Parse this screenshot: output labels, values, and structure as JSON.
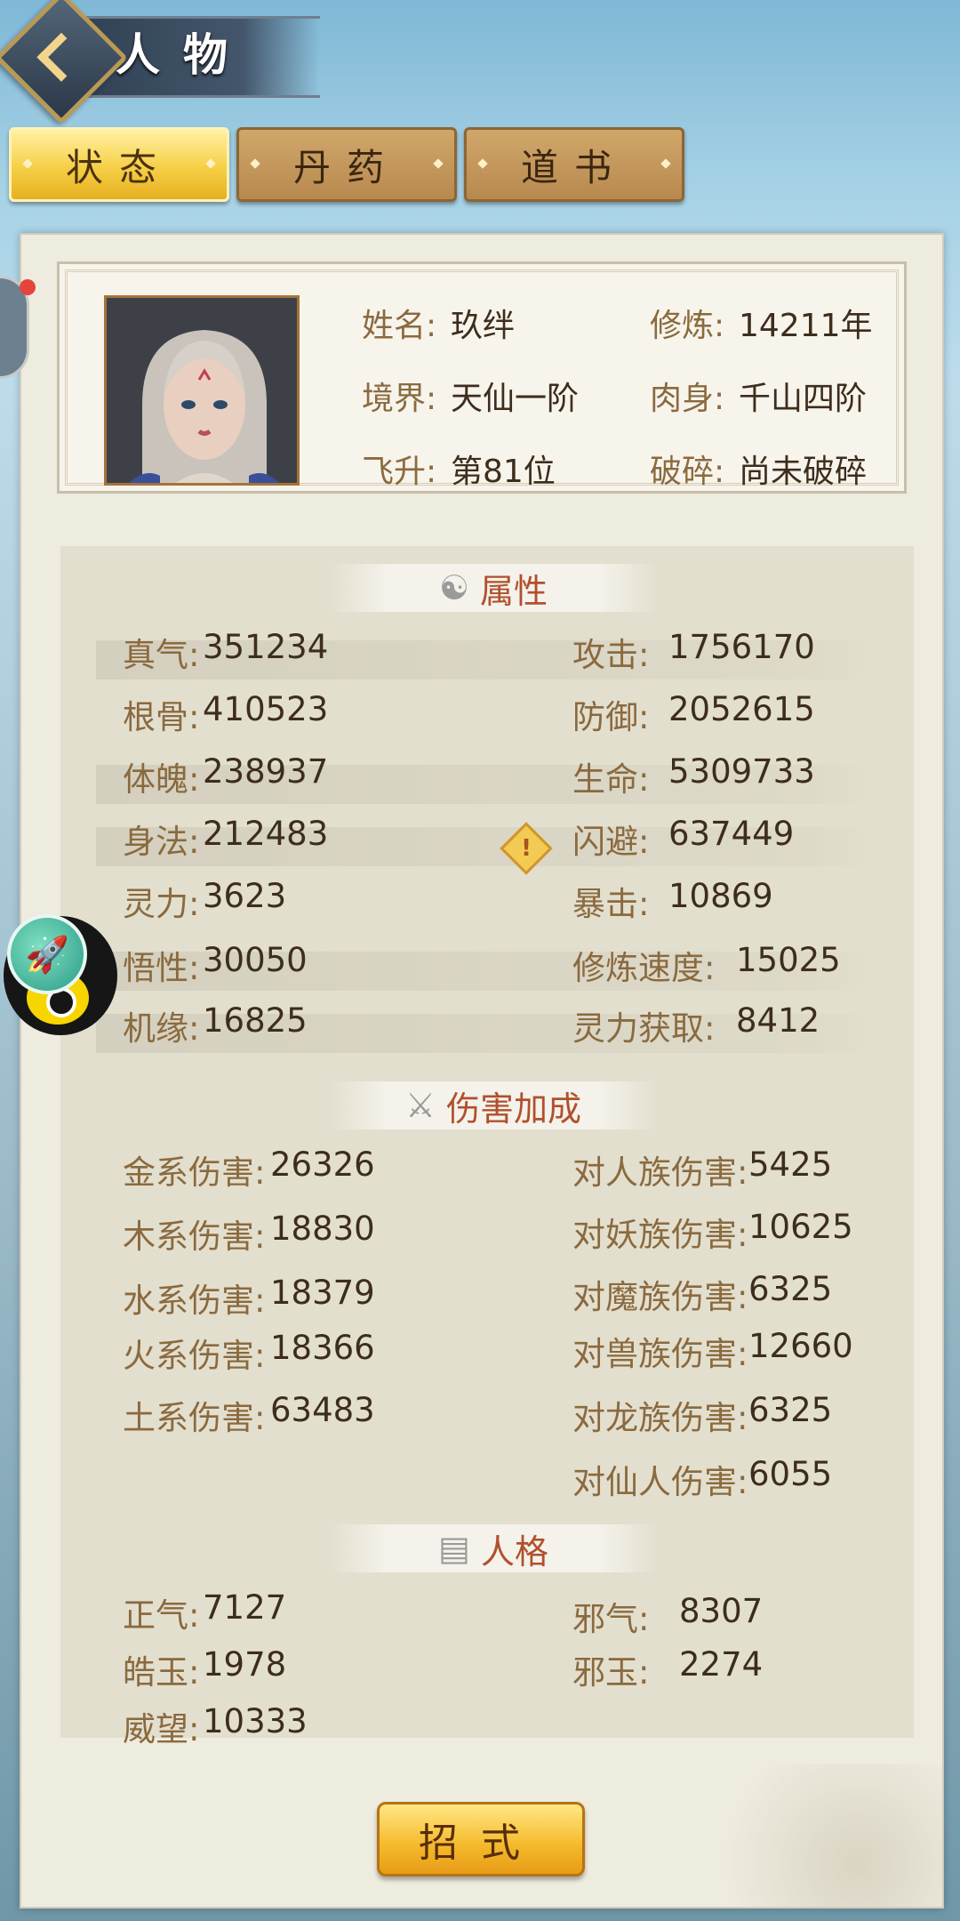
{
  "header": {
    "title": "人物"
  },
  "tabs": [
    {
      "label": "状态",
      "active": true
    },
    {
      "label": "丹药",
      "active": false
    },
    {
      "label": "道书",
      "active": false
    }
  ],
  "profile": {
    "name_label": "姓名:",
    "name": "玖绊",
    "realm_label": "境界:",
    "realm": "天仙一阶",
    "ascend_label": "飞升:",
    "ascend": "第81位",
    "cultivate_label": "修炼:",
    "cultivate": "14211年",
    "body_label": "肉身:",
    "body": "千山四阶",
    "break_label": "破碎:",
    "break": "尚未破碎"
  },
  "sections": {
    "attributes": {
      "title": "属性",
      "left": [
        {
          "label": "真气:",
          "value": "351234"
        },
        {
          "label": "根骨:",
          "value": "410523"
        },
        {
          "label": "体魄:",
          "value": "238937"
        },
        {
          "label": "身法:",
          "value": "212483"
        },
        {
          "label": "灵力:",
          "value": "3623"
        },
        {
          "label": "悟性:",
          "value": "30050"
        },
        {
          "label": "机缘:",
          "value": "16825"
        }
      ],
      "right": [
        {
          "label": "攻击:",
          "value": "1756170"
        },
        {
          "label": "防御:",
          "value": "2052615"
        },
        {
          "label": "生命:",
          "value": "5309733"
        },
        {
          "label": "闪避:",
          "value": "637449"
        },
        {
          "label": "暴击:",
          "value": "10869"
        },
        {
          "label": "修炼速度:",
          "value": "15025"
        },
        {
          "label": "灵力获取:",
          "value": "8412"
        }
      ]
    },
    "damage": {
      "title": "伤害加成",
      "left": [
        {
          "label": "金系伤害:",
          "value": "26326"
        },
        {
          "label": "木系伤害:",
          "value": "18830"
        },
        {
          "label": "水系伤害:",
          "value": "18379"
        },
        {
          "label": "火系伤害:",
          "value": "18366"
        },
        {
          "label": "土系伤害:",
          "value": "63483"
        }
      ],
      "right": [
        {
          "label": "对人族伤害:",
          "value": "5425"
        },
        {
          "label": "对妖族伤害:",
          "value": "10625"
        },
        {
          "label": "对魔族伤害:",
          "value": "6325"
        },
        {
          "label": "对兽族伤害:",
          "value": "12660"
        },
        {
          "label": "对龙族伤害:",
          "value": "6325"
        },
        {
          "label": "对仙人伤害:",
          "value": "6055"
        }
      ]
    },
    "personality": {
      "title": "人格",
      "left": [
        {
          "label": "正气:",
          "value": "7127"
        },
        {
          "label": "皓玉:",
          "value": "1978"
        },
        {
          "label": "威望:",
          "value": "10333"
        }
      ],
      "right": [
        {
          "label": "邪气:",
          "value": "8307"
        },
        {
          "label": "邪玉:",
          "value": "2274"
        }
      ]
    }
  },
  "bottom_button": "招式",
  "icons": [
    "back-arrow-icon",
    "yin-yang-icon",
    "crossed-swords-icon",
    "scroll-icon",
    "warning-icon",
    "rocket-icon",
    "eye-icon"
  ]
}
